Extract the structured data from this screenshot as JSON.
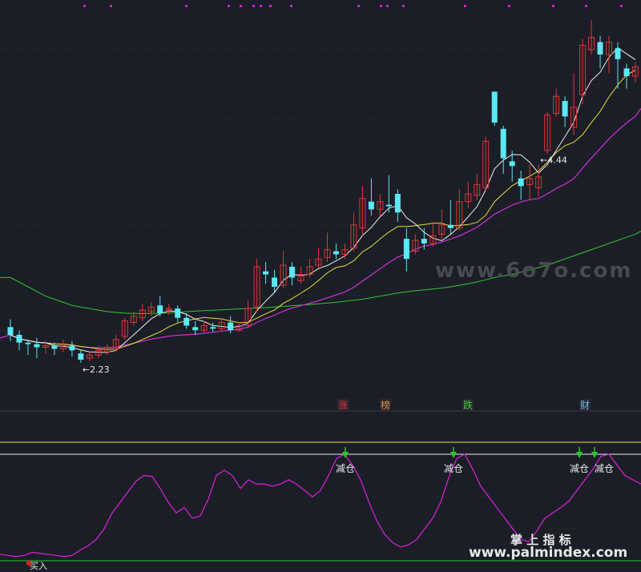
{
  "colors": {
    "background": "#1b1e26",
    "grid": "#2b3038",
    "up": "#e0343a",
    "down": "#5ce8f4",
    "ma5": "#f0f0f0",
    "ma10": "#e8e035",
    "ma20": "#d030d8",
    "ma60": "#30c830",
    "oscillator": "#d020d0",
    "band_top": "#e8e035",
    "band_mid": "#f0f0f0",
    "band_low": "#30c830",
    "marker_dot": "#d020d0",
    "signal_arrow": "#28c828",
    "buy_marker": "#e02020",
    "tag_zhang": "#e03030",
    "tag_bang": "#e09040",
    "tag_die": "#40d040",
    "tag_cai": "#60c0f0"
  },
  "chart_data": [
    {
      "type": "candlestick",
      "price_range": [
        1.96,
        4.52
      ],
      "annotations": [
        {
          "text": "4.44",
          "candle": 60,
          "arrow": "←",
          "position": "above"
        },
        {
          "text": "2.23",
          "candle": 8,
          "arrow": "←",
          "position": "below"
        }
      ],
      "candles": [
        [
          2.46,
          2.41,
          2.51,
          2.37
        ],
        [
          2.41,
          2.36,
          2.44,
          2.31
        ],
        [
          2.36,
          2.35,
          2.38,
          2.28
        ],
        [
          2.35,
          2.33,
          2.39,
          2.26
        ],
        [
          2.33,
          2.34,
          2.37,
          2.29
        ],
        [
          2.34,
          2.32,
          2.36,
          2.28
        ],
        [
          2.32,
          2.34,
          2.38,
          2.3
        ],
        [
          2.34,
          2.31,
          2.37,
          2.27
        ],
        [
          2.29,
          2.25,
          2.31,
          2.23
        ],
        [
          2.26,
          2.28,
          2.3,
          2.24
        ],
        [
          2.28,
          2.31,
          2.34,
          2.26
        ],
        [
          2.3,
          2.33,
          2.35,
          2.28
        ],
        [
          2.32,
          2.38,
          2.41,
          2.3
        ],
        [
          2.4,
          2.5,
          2.52,
          2.38
        ],
        [
          2.49,
          2.53,
          2.56,
          2.47
        ],
        [
          2.52,
          2.57,
          2.61,
          2.5
        ],
        [
          2.56,
          2.59,
          2.62,
          2.53
        ],
        [
          2.6,
          2.55,
          2.66,
          2.53
        ],
        [
          2.57,
          2.58,
          2.61,
          2.54
        ],
        [
          2.58,
          2.52,
          2.6,
          2.49
        ],
        [
          2.52,
          2.47,
          2.55,
          2.45
        ],
        [
          2.46,
          2.44,
          2.5,
          2.41
        ],
        [
          2.44,
          2.47,
          2.5,
          2.42
        ],
        [
          2.46,
          2.45,
          2.49,
          2.43
        ],
        [
          2.45,
          2.49,
          2.52,
          2.43
        ],
        [
          2.49,
          2.44,
          2.53,
          2.42
        ],
        [
          2.44,
          2.47,
          2.49,
          2.43
        ],
        [
          2.47,
          2.58,
          2.63,
          2.45
        ],
        [
          2.59,
          2.85,
          2.9,
          2.56
        ],
        [
          2.82,
          2.8,
          2.88,
          2.74
        ],
        [
          2.78,
          2.72,
          2.83,
          2.68
        ],
        [
          2.73,
          2.86,
          2.95,
          2.71
        ],
        [
          2.85,
          2.78,
          2.88,
          2.73
        ],
        [
          2.76,
          2.8,
          2.85,
          2.74
        ],
        [
          2.8,
          2.85,
          2.9,
          2.78
        ],
        [
          2.86,
          2.9,
          2.97,
          2.84
        ],
        [
          2.91,
          2.96,
          3.07,
          2.88
        ],
        [
          2.95,
          2.93,
          3.0,
          2.9
        ],
        [
          2.93,
          2.96,
          3.0,
          2.9
        ],
        [
          2.97,
          3.12,
          3.2,
          2.95
        ],
        [
          3.1,
          3.29,
          3.37,
          3.05
        ],
        [
          3.27,
          3.22,
          3.42,
          3.18
        ],
        [
          3.22,
          3.27,
          3.32,
          3.18
        ],
        [
          3.25,
          3.24,
          3.44,
          3.2
        ],
        [
          3.32,
          3.2,
          3.35,
          3.14
        ],
        [
          3.03,
          2.9,
          3.1,
          2.82
        ],
        [
          2.95,
          3.02,
          3.06,
          2.93
        ],
        [
          3.03,
          3.0,
          3.1,
          2.96
        ],
        [
          3.0,
          3.05,
          3.14,
          2.98
        ],
        [
          3.06,
          3.12,
          3.22,
          3.03
        ],
        [
          3.12,
          3.1,
          3.28,
          3.06
        ],
        [
          3.1,
          3.27,
          3.35,
          3.08
        ],
        [
          3.27,
          3.32,
          3.4,
          3.23
        ],
        [
          3.31,
          3.38,
          3.45,
          3.28
        ],
        [
          3.36,
          3.66,
          3.69,
          3.34
        ],
        [
          3.98,
          3.78,
          3.98,
          3.76
        ],
        [
          3.74,
          3.55,
          3.76,
          3.45
        ],
        [
          3.53,
          3.5,
          3.6,
          3.4
        ],
        [
          3.42,
          3.37,
          3.47,
          3.28
        ],
        [
          3.38,
          3.42,
          3.51,
          3.28
        ],
        [
          3.36,
          3.43,
          3.51,
          3.3
        ],
        [
          3.6,
          3.83,
          3.85,
          3.58
        ],
        [
          3.84,
          3.95,
          4.0,
          3.82
        ],
        [
          3.92,
          3.82,
          3.95,
          3.75
        ],
        [
          3.75,
          3.88,
          4.1,
          3.7
        ],
        [
          3.96,
          4.28,
          4.32,
          3.9
        ],
        [
          4.25,
          4.33,
          4.44,
          4.22
        ],
        [
          4.3,
          4.22,
          4.34,
          4.13
        ],
        [
          4.22,
          4.3,
          4.34,
          4.1
        ],
        [
          4.26,
          4.19,
          4.3,
          4.0
        ],
        [
          4.13,
          4.08,
          4.16,
          4.0
        ],
        [
          4.08,
          4.14,
          4.17,
          4.04
        ]
      ],
      "series": [
        {
          "name": "",
          "color_key": "ma60",
          "values": [
            2.78,
            2.75,
            2.72,
            2.69,
            2.66,
            2.64,
            2.62,
            2.6,
            2.59,
            2.58,
            2.57,
            2.56,
            2.555,
            2.55,
            2.548,
            2.547,
            2.548,
            2.55,
            2.552,
            2.555,
            2.56,
            2.563,
            2.566,
            2.569,
            2.572,
            2.575,
            2.578,
            2.58,
            2.583,
            2.586,
            2.59,
            2.594,
            2.598,
            2.602,
            2.606,
            2.61,
            2.615,
            2.62,
            2.627,
            2.634,
            2.64,
            2.65,
            2.66,
            2.67,
            2.68,
            2.688,
            2.695,
            2.7,
            2.706,
            2.712,
            2.72,
            2.73,
            2.74,
            2.752,
            2.765,
            2.78,
            2.79,
            2.8,
            2.815,
            2.83,
            2.845,
            2.86,
            2.88,
            2.9,
            2.92,
            2.94,
            2.96,
            2.98,
            3.0,
            3.02,
            3.04,
            3.06
          ]
        }
      ]
    },
    {
      "type": "line",
      "band_labels": {
        "zhang": "涨",
        "bang": "榜",
        "die": "跌",
        "cai": "财"
      },
      "signals": [
        {
          "text": "减仓",
          "index": 24,
          "type": "arrow"
        },
        {
          "text": "减仓",
          "index": 31,
          "type": "arrow"
        },
        {
          "text": "减仓",
          "index": 40,
          "type": "arrow"
        },
        {
          "text": "减仓",
          "index": 41,
          "type": "arrow"
        },
        {
          "text": "买入",
          "index": 1,
          "type": "diamond"
        }
      ],
      "series": [
        {
          "name": "",
          "values": [
            6,
            5,
            4,
            5,
            8,
            7,
            6,
            5,
            4,
            5,
            10,
            14,
            20,
            30,
            45,
            55,
            65,
            75,
            80,
            79,
            68,
            55,
            45,
            50,
            40,
            42,
            58,
            80,
            85,
            80,
            68,
            76,
            72,
            72,
            70,
            72,
            76,
            72,
            66,
            60,
            66,
            80,
            96,
            100,
            90,
            76,
            56,
            38,
            25,
            17,
            13,
            15,
            20,
            30,
            40,
            55,
            78,
            96,
            100,
            86,
            70,
            60,
            50,
            40,
            30,
            20,
            18,
            28,
            40,
            45,
            50,
            56,
            66,
            76,
            86,
            98,
            100,
            90,
            80,
            76,
            72
          ]
        }
      ]
    }
  ],
  "watermark": {
    "site": "www.6o7o.com",
    "brand": "掌 上 指 标",
    "brand_url": "www.palmindex.com"
  }
}
